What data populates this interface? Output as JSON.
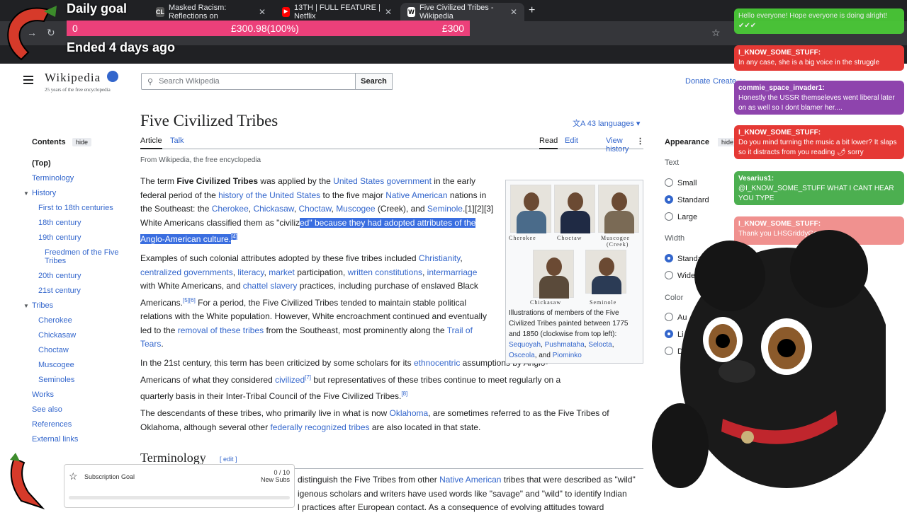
{
  "browser": {
    "tabs": [
      {
        "label": "Masked Racism: Reflections on",
        "fav": "CL",
        "fav_color": "#ffffff"
      },
      {
        "label": "13TH | FULL FEATURE | Netflix",
        "fav": "▶",
        "fav_color": "#ff0000"
      },
      {
        "label": "Five Civilized Tribes - Wikipedia",
        "fav": "W",
        "fav_color": "#ffffff"
      }
    ]
  },
  "donation_goal": {
    "title": "Daily goal",
    "start": "0",
    "current": "£300.98(100%)",
    "target": "£300",
    "status": "Ended 4 days ago",
    "progress_fraction": 1.0
  },
  "wiki": {
    "logo_name": "Wikipedia",
    "logo_tag": "25 years of the free encyclopedia",
    "search_placeholder": "Search Wikipedia",
    "search_button": "Search",
    "donate": "Donate",
    "create": "Create",
    "title": "Five Civilized Tribes",
    "languages": "43 languages",
    "tab_article": "Article",
    "tab_talk": "Talk",
    "tab_read": "Read",
    "tab_edit": "Edit",
    "tab_history": "View history",
    "from": "From Wikipedia, the free encyclopedia",
    "toc_heading": "Contents",
    "toc_hide": "hide",
    "toc": [
      {
        "label": "(Top)"
      },
      {
        "label": "Terminology"
      },
      {
        "label": "History"
      },
      {
        "label": "First to 18th centuries"
      },
      {
        "label": "18th century"
      },
      {
        "label": "19th century"
      },
      {
        "label": "Freedmen of the Five"
      },
      {
        "label": "Tribes"
      },
      {
        "label": "20th century"
      },
      {
        "label": "21st century"
      },
      {
        "label": "Tribes"
      },
      {
        "label": "Cherokee"
      },
      {
        "label": "Chickasaw"
      },
      {
        "label": "Choctaw"
      },
      {
        "label": "Muscogee"
      },
      {
        "label": "Seminoles"
      },
      {
        "label": "Works"
      },
      {
        "label": "See also"
      },
      {
        "label": "References"
      },
      {
        "label": "External links"
      }
    ],
    "appearance": {
      "heading": "Appearance",
      "hide": "hide",
      "text_label": "Text",
      "text_opts": [
        "Small",
        "Standard",
        "Large"
      ],
      "width_label": "Width",
      "width_opts": [
        "Standard",
        "Wide"
      ],
      "color_label": "Color",
      "color_opts": [
        "Au",
        "Li",
        "Da"
      ]
    },
    "infobox": {
      "captions": [
        "Cherokee",
        "Choctaw",
        "Muscogee",
        "(Creek)",
        "Chickasaw",
        "Seminole"
      ],
      "caption_text": "Illustrations of members of the Five Civilized Tribes painted between 1775 and 1850 (clockwise from top left):",
      "names": [
        "Sequoyah",
        "Pushmataha",
        "Selocta",
        "Osceola",
        "Piominko"
      ],
      "sep": ", ",
      "and": ", and "
    },
    "p1": {
      "a": "The term ",
      "b": "Five Civilized Tribes",
      "c": " was applied by the ",
      "l1": "United States government",
      "d": " in the early federal period of the ",
      "l2": "history of the United States",
      "e": " to the five major ",
      "l3": "Native American",
      "f": " nations in the Southeast: the ",
      "l4": "Cherokee",
      "g": ", ",
      "l5": "Chickasaw",
      "h": ", ",
      "l6": "Choctaw",
      "i": ", ",
      "l7": "Muscogee",
      "j": " (Creek), and ",
      "l8": "Seminole",
      "k": ".[1][2][3] White Americans classified them as \"civiliz",
      "sel": "ed\" because they had adopted attributes of the Anglo-American culture.",
      "ref": "[4]"
    },
    "p2": {
      "a": "Examples of such colonial attributes adopted by these five tribes included ",
      "l1": "Christianity",
      "b": ", ",
      "l2": "centralized governments",
      "c": ", ",
      "l3": "literacy",
      "d": ", ",
      "l4": "market",
      "e": " participation, ",
      "l5": "written constitutions",
      "f": ", ",
      "l6": "intermarriage",
      "g": " with White Americans, and ",
      "l7": "chattel slavery",
      "h": " practices, including purchase of enslaved Black Americans.",
      "ref": "[5][6]",
      "i": " For a period, the Five Civilized Tribes tended to maintain stable political relations with the White population. However, White encroachment continued and eventually led to the ",
      "l8": "removal of these tribes",
      "j": " from the Southeast, most prominently along the ",
      "l9": "Trail of Tears",
      "k": "."
    },
    "p3": {
      "a": "In the 21st century, this term has been criticized by some scholars for its ",
      "l1": "ethnocentric",
      "b": " assumptions by Anglo-Americans of what they considered ",
      "l2": "civilized",
      "ref1": "[7]",
      "c": " but representatives of these tribes continue to meet regularly on a quarterly basis in their Inter-Tribal Council of the Five Civilized Tribes.",
      "ref2": "[8]"
    },
    "p4": {
      "a": "The descendants of these tribes, who primarily live in what is now ",
      "l1": "Oklahoma",
      "b": ", are sometimes referred to as the Five Tribes of Oklahoma, although several other ",
      "l2": "federally recognized tribes",
      "c": " are also located in that state."
    },
    "terminology": "Terminology",
    "term_edit": "[ edit ]",
    "p5": {
      "a": "distinguish the Five Tribes from other ",
      "l1": "Native American",
      "b": " tribes that were described as \"wild\"",
      "c": "igenous scholars and writers have used words like \"savage\" and \"wild\" to identify Indian",
      "d": "l practices after European contact. As a consequence of evolving attitudes toward"
    }
  },
  "chat": [
    {
      "user": "",
      "text": "Hello everyone! Hope everyone is doing alright! ✔✔✔",
      "color": "#4cd137"
    },
    {
      "user": "I_KNOW_SOME_STUFF:",
      "text": "In any case, she is a big voice in the struggle",
      "color": "#e53935"
    },
    {
      "user": "commie_space_invader1:",
      "text": "Honestly the USSR themseleves went liberal later on as well so I dont blamer her....",
      "color": "#8e44ad"
    },
    {
      "user": "I_KNOW_SOME_STUFF:",
      "text": "Do you mind turning the music a bit lower? It slaps so it distracts from you reading 🌶 sorry",
      "color": "#e53935"
    },
    {
      "user": "Vesarius1:",
      "text": "@I_KNOW_SOME_STUFF WHAT I CANT HEAR YOU TYPE",
      "color": "#4caf50"
    },
    {
      "user": "I_KNOW_SOME_STUFF:",
      "text": "Thank you LHSGriddyGoose",
      "color": "#e53935"
    }
  ],
  "sub_goal": {
    "label": "Subscription Goal",
    "count": "0 / 10",
    "sub_label": "New Subs",
    "progress_fraction": 0
  }
}
